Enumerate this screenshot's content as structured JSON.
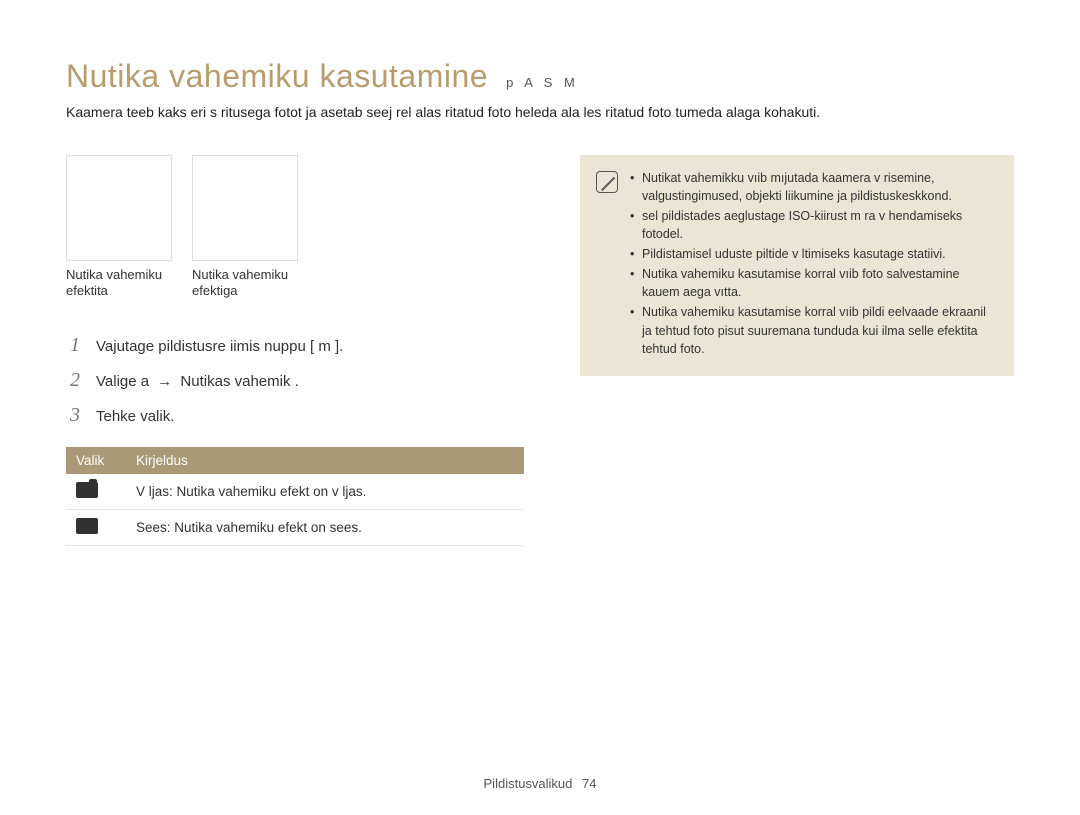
{
  "header": {
    "title": "Nutika vahemiku kasutamine",
    "modes": "p A S M"
  },
  "intro": "Kaamera teeb kaks eri s ritusega fotot ja asetab seej rel alas ritatud foto heleda ala  les ritatud foto tumeda alaga kohakuti.",
  "thumbs": {
    "without": "Nutika vahemiku efektita",
    "with": "Nutika vahemiku efektiga"
  },
  "steps": {
    "s1_num": "1",
    "s1_text": "Vajutage pildistusre iimis nuppu [ m        ].",
    "s2_num": "2",
    "s2_prefix": "Valige a    ",
    "s2_suffix": " Nutikas vahemik .",
    "s3_num": "3",
    "s3_text": "Tehke valik."
  },
  "table": {
    "head_option": "Valik",
    "head_desc": "Kirjeldus",
    "row_off_label": "V ljas",
    "row_off_desc": ": Nutika vahemiku efekt on v ljas.",
    "row_on_label": "Sees",
    "row_on_desc": ": Nutika vahemiku efekt on sees."
  },
  "notes": {
    "n1": "Nutikat vahemikku vıib mıjutada kaamera v risemine, valgustingimused, objekti liikumine ja pildistuskeskkond.",
    "n2": "   sel pildistades aeglustage ISO-kiirust m ra v hendamiseks fotodel.",
    "n3": "Pildistamisel uduste piltide v ltimiseks kasutage statiivi.",
    "n4": "Nutika vahemiku kasutamise korral vıib foto salvestamine kauem aega vıtta.",
    "n5": "Nutika vahemiku kasutamise korral vıib pildi eelvaade ekraanil ja tehtud foto pisut suuremana tunduda kui ilma selle efektita tehtud foto."
  },
  "footer": {
    "section": "Pildistusvalikud",
    "page": "74"
  }
}
